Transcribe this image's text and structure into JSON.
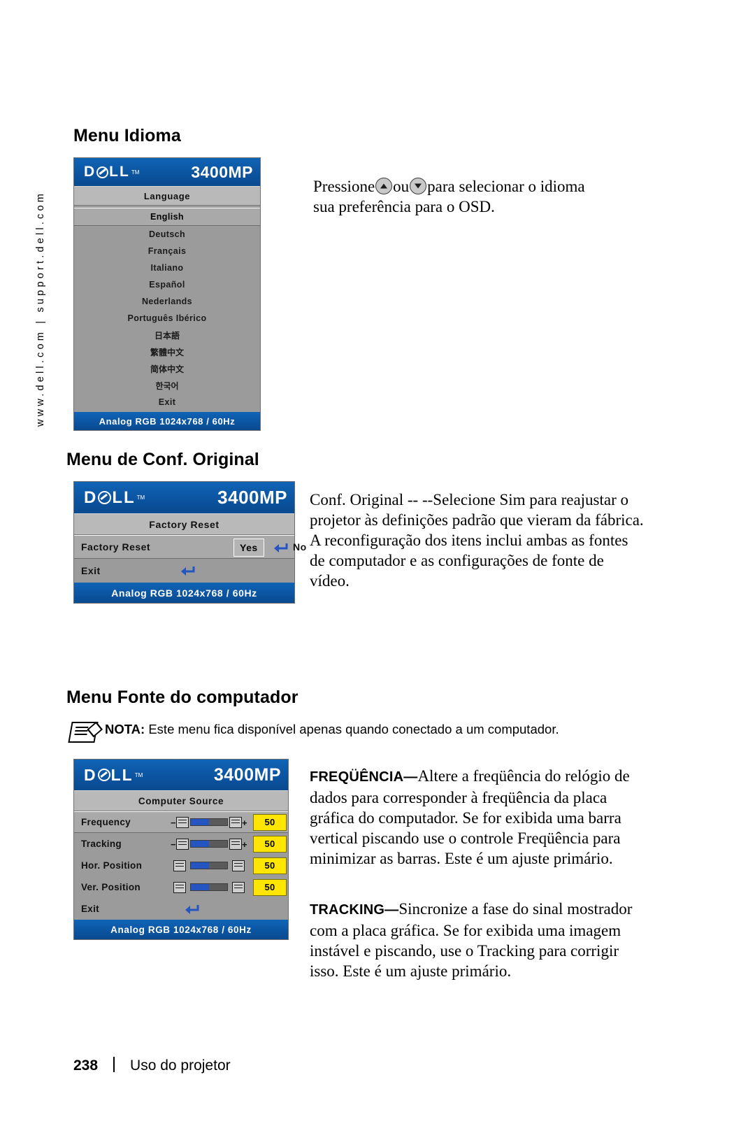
{
  "sidebar": {
    "url": "www.dell.com | support.dell.com"
  },
  "sections": {
    "language": {
      "heading": "Menu Idioma",
      "osd": {
        "brand": "D",
        "brand_rest": "LL",
        "tm": "TM",
        "model": "3400MP",
        "title": "Language",
        "items": [
          "English",
          "Deutsch",
          "Français",
          "Italiano",
          "Español",
          "Nederlands",
          "Português Ibérico",
          "日本語",
          "繁體中文",
          "简体中文",
          "한국어",
          "Exit"
        ],
        "selected_index": 0,
        "footer": "Analog RGB 1024x768 / 60Hz"
      },
      "text_before": "Pressione",
      "text_middle": "ou",
      "text_after": "para selecionar o idioma",
      "text_line2": "sua preferência para o OSD."
    },
    "factory_reset": {
      "heading": "Menu de Conf. Original",
      "osd": {
        "model": "3400MP",
        "title": "Factory Reset",
        "row_label": "Factory Reset",
        "yes": "Yes",
        "no": "No",
        "exit": "Exit",
        "footer": "Analog RGB 1024x768 / 60Hz"
      },
      "paragraph": "Conf. Original -- --Selecione Sim para reajustar o projetor às definições padrão que vieram da fábrica. A reconfiguração dos itens inclui ambas as fontes de computador e as configurações de fonte de vídeo."
    },
    "computer_source": {
      "heading": "Menu Fonte do computador",
      "note_label": "NOTA:",
      "note_text": "Este menu fica disponível apenas quando conectado a um computador.",
      "osd": {
        "model": "3400MP",
        "title": "Computer Source",
        "rows": [
          {
            "label": "Frequency",
            "value": "50",
            "fill": 50
          },
          {
            "label": "Tracking",
            "value": "50",
            "fill": 50
          },
          {
            "label": "Hor. Position",
            "value": "50",
            "fill": 50
          },
          {
            "label": "Ver. Position",
            "value": "50",
            "fill": 50
          }
        ],
        "exit": "Exit",
        "footer": "Analog RGB 1024x768 / 60Hz"
      },
      "p1_term": "FREQÜÊNCIA—",
      "p1_text": "Altere a freqüência do relógio de dados para corresponder à freqüência da placa gráfica do computador. Se for exibida uma barra vertical piscando use o controle Freqüência para minimizar as barras. Este é um ajuste primário.",
      "p2_term": "TRACKING—",
      "p2_text": "Sincronize a fase do sinal mostrador com a placa gráfica. Se for exibida uma imagem instável e piscando, use o Tracking para corrigir isso. Este é um ajuste primário."
    }
  },
  "footer": {
    "page": "238",
    "label": "Uso do projetor"
  }
}
